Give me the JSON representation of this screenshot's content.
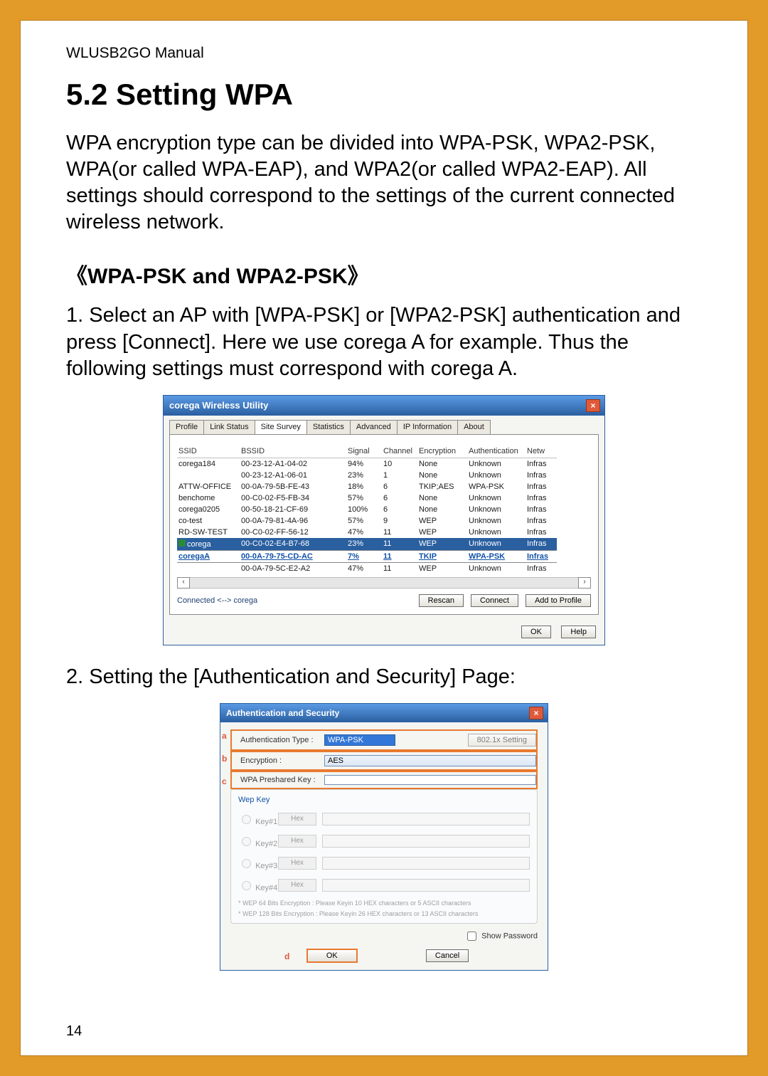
{
  "doc": {
    "header": "WLUSB2GO  Manual",
    "section_title": "5.2 Setting WPA",
    "intro": "WPA encryption type can be divided into WPA-PSK, WPA2-PSK, WPA(or called WPA-EAP), and WPA2(or called WPA2-EAP). All settings should correspond to the settings of the current connected wireless network.",
    "subsection": "《WPA-PSK and WPA2-PSK》",
    "step1_num": "1.",
    "step1_text": "Select an AP with [WPA-PSK] or [WPA2-PSK] authentication and press [Connect]. Here we use corega A for example. Thus the following settings must correspond with corega A.",
    "step2_num": "2.",
    "step2_text": "Setting the [Authentication and Security] Page:",
    "page_number": "14"
  },
  "dlg1": {
    "title": "corega Wireless Utility",
    "tabs": [
      "Profile",
      "Link Status",
      "Site Survey",
      "Statistics",
      "Advanced",
      "IP Information",
      "About"
    ],
    "active_tab": 2,
    "columns": [
      "SSID",
      "BSSID",
      "Signal",
      "Channel",
      "Encryption",
      "Authentication",
      "Netw"
    ],
    "rows": [
      {
        "ssid": "corega184",
        "bssid": "00-23-12-A1-04-02",
        "signal": "94%",
        "channel": "10",
        "enc": "None",
        "auth": "Unknown",
        "net": "Infras"
      },
      {
        "ssid": "",
        "bssid": "00-23-12-A1-06-01",
        "signal": "23%",
        "channel": "1",
        "enc": "None",
        "auth": "Unknown",
        "net": "Infras"
      },
      {
        "ssid": "ATTW-OFFICE",
        "bssid": "00-0A-79-5B-FE-43",
        "signal": "18%",
        "channel": "6",
        "enc": "TKIP;AES",
        "auth": "WPA-PSK",
        "net": "Infras"
      },
      {
        "ssid": "benchome",
        "bssid": "00-C0-02-F5-FB-34",
        "signal": "57%",
        "channel": "6",
        "enc": "None",
        "auth": "Unknown",
        "net": "Infras"
      },
      {
        "ssid": "corega0205",
        "bssid": "00-50-18-21-CF-69",
        "signal": "100%",
        "channel": "6",
        "enc": "None",
        "auth": "Unknown",
        "net": "Infras"
      },
      {
        "ssid": "co-test",
        "bssid": "00-0A-79-81-4A-96",
        "signal": "57%",
        "channel": "9",
        "enc": "WEP",
        "auth": "Unknown",
        "net": "Infras"
      },
      {
        "ssid": "RD-SW-TEST",
        "bssid": "00-C0-02-FF-56-12",
        "signal": "47%",
        "channel": "11",
        "enc": "WEP",
        "auth": "Unknown",
        "net": "Infras"
      },
      {
        "ssid": "corega",
        "bssid": "00-C0-02-E4-B7-68",
        "signal": "23%",
        "channel": "11",
        "enc": "WEP",
        "auth": "Unknown",
        "net": "Infras",
        "icon": true,
        "highlight": true
      },
      {
        "ssid": "coregaA",
        "bssid": "00-0A-79-75-CD-AC",
        "signal": "7%",
        "channel": "11",
        "enc": "TKIP",
        "auth": "WPA-PSK",
        "net": "Infras",
        "selected": true
      },
      {
        "ssid": "",
        "bssid": "00-0A-79-5C-E2-A2",
        "signal": "47%",
        "channel": "11",
        "enc": "WEP",
        "auth": "Unknown",
        "net": "Infras"
      }
    ],
    "connected_text": "Connected  <-->  corega",
    "btn_rescan": "Rescan",
    "btn_connect": "Connect",
    "btn_add": "Add to Profile",
    "btn_ok": "OK",
    "btn_help": "Help"
  },
  "dlg2": {
    "title": "Authentication and Security",
    "labels": {
      "auth_type": "Authentication Type :",
      "encryption": "Encryption :",
      "psk": "WPA Preshared Key :",
      "wep_title": "Wep Key",
      "key1": "Key#1",
      "key2": "Key#2",
      "key3": "Key#3",
      "key4": "Key#4",
      "hex": "Hex",
      "footnote1": "* WEP 64 Bits Encryption : Please Keyin 10 HEX characters or 5 ASCII characters",
      "footnote2": "* WEP 128 Bits Encryption : Please Keyin 26 HEX characters or 13 ASCII characters",
      "show_pw": "Show Password",
      "ok": "OK",
      "cancel": "Cancel",
      "btn_8021x": "802.1x Setting"
    },
    "values": {
      "auth_type": "WPA-PSK",
      "encryption": "AES"
    },
    "annot": {
      "a": "a",
      "b": "b",
      "c": "c",
      "d": "d"
    }
  }
}
